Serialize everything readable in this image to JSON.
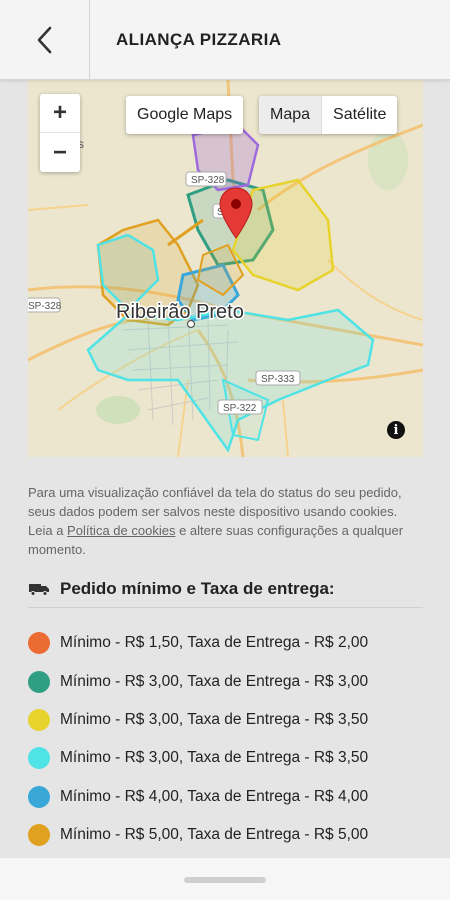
{
  "header": {
    "title": "ALIANÇA PIZZARIA",
    "back_icon": "chevron-left-icon"
  },
  "map": {
    "zoom_in": "+",
    "zoom_out": "−",
    "google_maps_button": "Google Maps",
    "map_types": [
      "Mapa",
      "Satélite"
    ],
    "active_map_type": "Mapa",
    "city_label": "Ribeirão Preto",
    "road_labels": [
      "SP-328",
      "SP-328",
      "SP-333",
      "SP-322",
      "SP-328"
    ],
    "partial_label": "s",
    "info_icon": "i"
  },
  "notice": {
    "text_before": "Para uma visualização confiável da tela do status do seu pedido, seus dados podem ser salvos neste dispositivo usando cookies. Leia a ",
    "link_text": "Política de cookies",
    "text_after": " e altere suas configurações a qualquer momento."
  },
  "delivery": {
    "title": "Pedido mínimo e Taxa de entrega:",
    "icon": "delivery-truck-icon",
    "zones": [
      {
        "label": "Mínimo - R$ 1,50, Taxa de Entrega - R$ 2,00",
        "color": "#ec6b33"
      },
      {
        "label": "Mínimo - R$ 3,00, Taxa de Entrega - R$ 3,00",
        "color": "#2f9e83"
      },
      {
        "label": "Mínimo - R$ 3,00, Taxa de Entrega - R$ 3,50",
        "color": "#e8d22c"
      },
      {
        "label": "Mínimo - R$ 3,00, Taxa de Entrega - R$ 3,50",
        "color": "#4fe3e6"
      },
      {
        "label": "Mínimo - R$ 4,00, Taxa de Entrega - R$ 4,00",
        "color": "#3aa7d9"
      },
      {
        "label": "Mínimo - R$ 5,00, Taxa de Entrega - R$ 5,00",
        "color": "#e0a020"
      }
    ]
  }
}
